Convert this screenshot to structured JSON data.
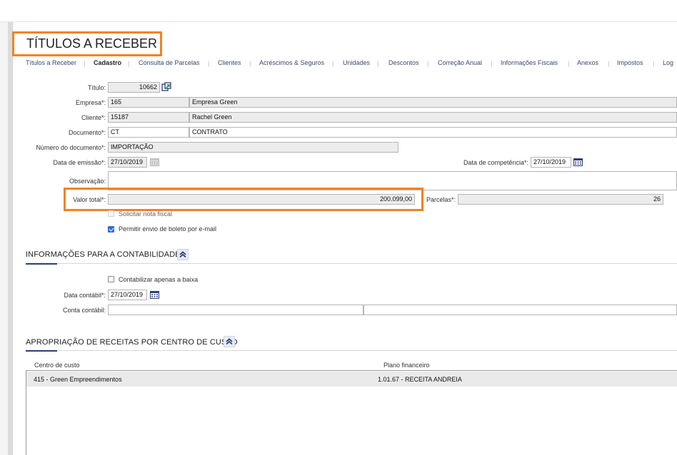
{
  "page": {
    "title": "TÍTULOS A RECEBER"
  },
  "tabs": [
    {
      "label": "Títulos a Receber"
    },
    {
      "label": "Cadastro"
    },
    {
      "label": "Consulta de Parcelas"
    },
    {
      "label": "Clientes"
    },
    {
      "label": "Acréscimos & Seguros"
    },
    {
      "label": "Unidades"
    },
    {
      "label": "Descontos"
    },
    {
      "label": "Correção Anual"
    },
    {
      "label": "Informações Fiscais"
    },
    {
      "label": "Anexos"
    },
    {
      "label": "Impostos"
    },
    {
      "label": "Log"
    }
  ],
  "active_tab": "Cadastro",
  "form": {
    "titulo": {
      "label": "Título:",
      "value": "10662"
    },
    "empresa": {
      "label": "Empresa*:",
      "code": "165",
      "name": "Empresa Green"
    },
    "cliente": {
      "label": "Cliente*:",
      "code": "15187",
      "name": "Rachel Green"
    },
    "documento": {
      "label": "Documento*:",
      "code": "CT",
      "name": "CONTRATO"
    },
    "numero_documento": {
      "label": "Número do documento*:",
      "value": "IMPORTAÇÃO"
    },
    "data_emissao": {
      "label": "Data de emissão*:",
      "value": "27/10/2019"
    },
    "data_competencia": {
      "label": "Data de competência*:",
      "value": "27/10/2019"
    },
    "observacao": {
      "label": "Observação:",
      "value": ""
    },
    "valor_total": {
      "label": "Valor total*:",
      "value": "200.099,00"
    },
    "parcelas": {
      "label": "Parcelas*:",
      "value": "26"
    },
    "solicitar_nota": {
      "label": "Solicitar nota fiscal",
      "checked": false,
      "disabled": true
    },
    "permitir_boleto": {
      "label": "Permitir envio de boleto por e-mail",
      "checked": true
    }
  },
  "contabilidade": {
    "title": "INFORMAÇÕES PARA A CONTABILIDADE",
    "contabilizar_baixa": {
      "label": "Contabilizar apenas a baixa",
      "checked": false
    },
    "data_contabil": {
      "label": "Data contábil*:",
      "value": "27/10/2019"
    },
    "conta_contabil": {
      "label": "Conta contábil:",
      "code": "",
      "name": ""
    }
  },
  "apropriacao": {
    "title": "APROPRIAÇÃO DE RECEITAS POR CENTRO DE CUSTO",
    "columns": [
      "Centro de custo",
      "Plano financeiro"
    ],
    "rows": [
      {
        "centro": "415 - Green Empreendimentos",
        "plano": "1.01.67 - RECEITA ANDREIA"
      }
    ]
  },
  "colors": {
    "highlight": "#f5821f",
    "accent": "#2b3f7a",
    "checkbox": "#2f6fd6"
  }
}
